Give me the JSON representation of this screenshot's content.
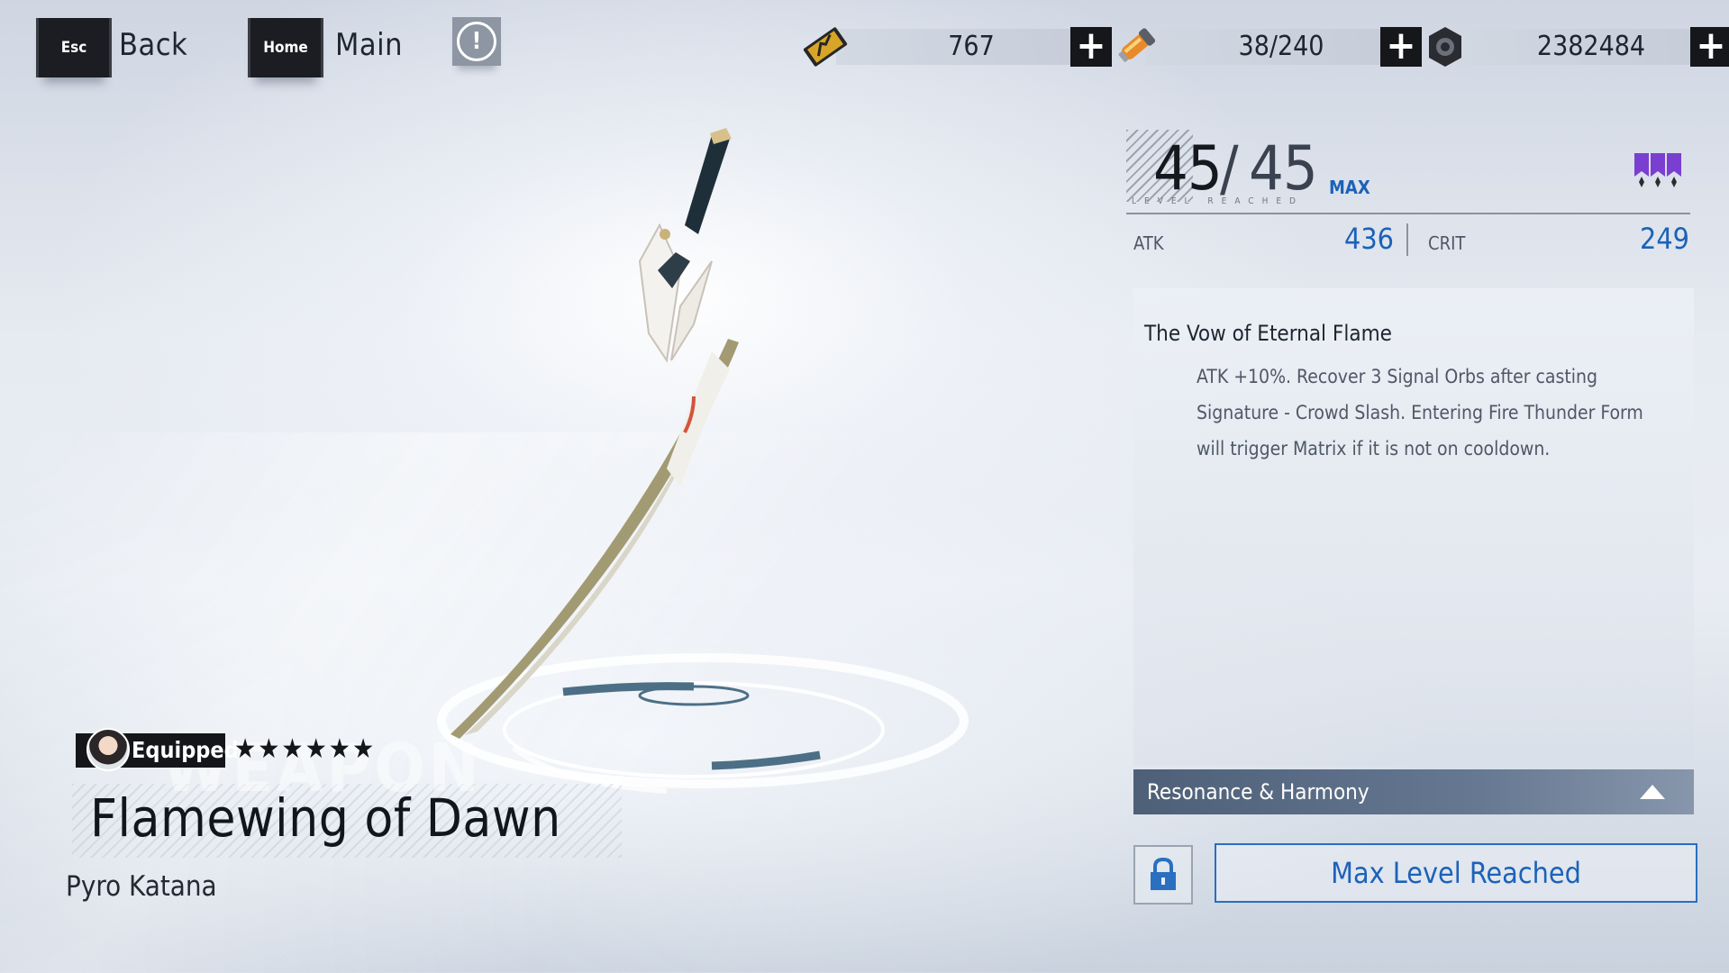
{
  "nav": {
    "back_key": "Esc",
    "back_label": "Back",
    "home_key": "Home",
    "home_label": "Main",
    "info_glyph": "!"
  },
  "currencies": [
    {
      "icon": "ticket-icon",
      "value": "767"
    },
    {
      "icon": "energy-vial-icon",
      "value": "38/240"
    },
    {
      "icon": "gear-nut-icon",
      "value": "2382484"
    }
  ],
  "weapon": {
    "level_current": "45",
    "level_slash": "/",
    "level_max": "45",
    "max_tag": "MAX",
    "level_caption": "LEVEL REACHED",
    "stats": [
      {
        "label": "ATK",
        "value": "436"
      },
      {
        "label": "CRIT",
        "value": "249"
      }
    ],
    "effect_title": "The Vow of Eternal Flame",
    "effect_desc": "ATK +10%. Recover 3 Signal Orbs after casting Signature - Crowd Slash. Entering Fire Thunder Form will trigger Matrix if it is not on cooldown.",
    "equipped_label": "Equipped",
    "stars": "★★★★★★",
    "watermark": "WEAPON",
    "name": "Flamewing of Dawn",
    "type": "Pyro Katana",
    "star_count": 6
  },
  "actions": {
    "resonance_label": "Resonance & Harmony",
    "max_button_label": "Max Level Reached"
  },
  "colors": {
    "accent": "#1b62b8",
    "dark": "#15171b",
    "rank_purple": "#7a3fd1"
  }
}
